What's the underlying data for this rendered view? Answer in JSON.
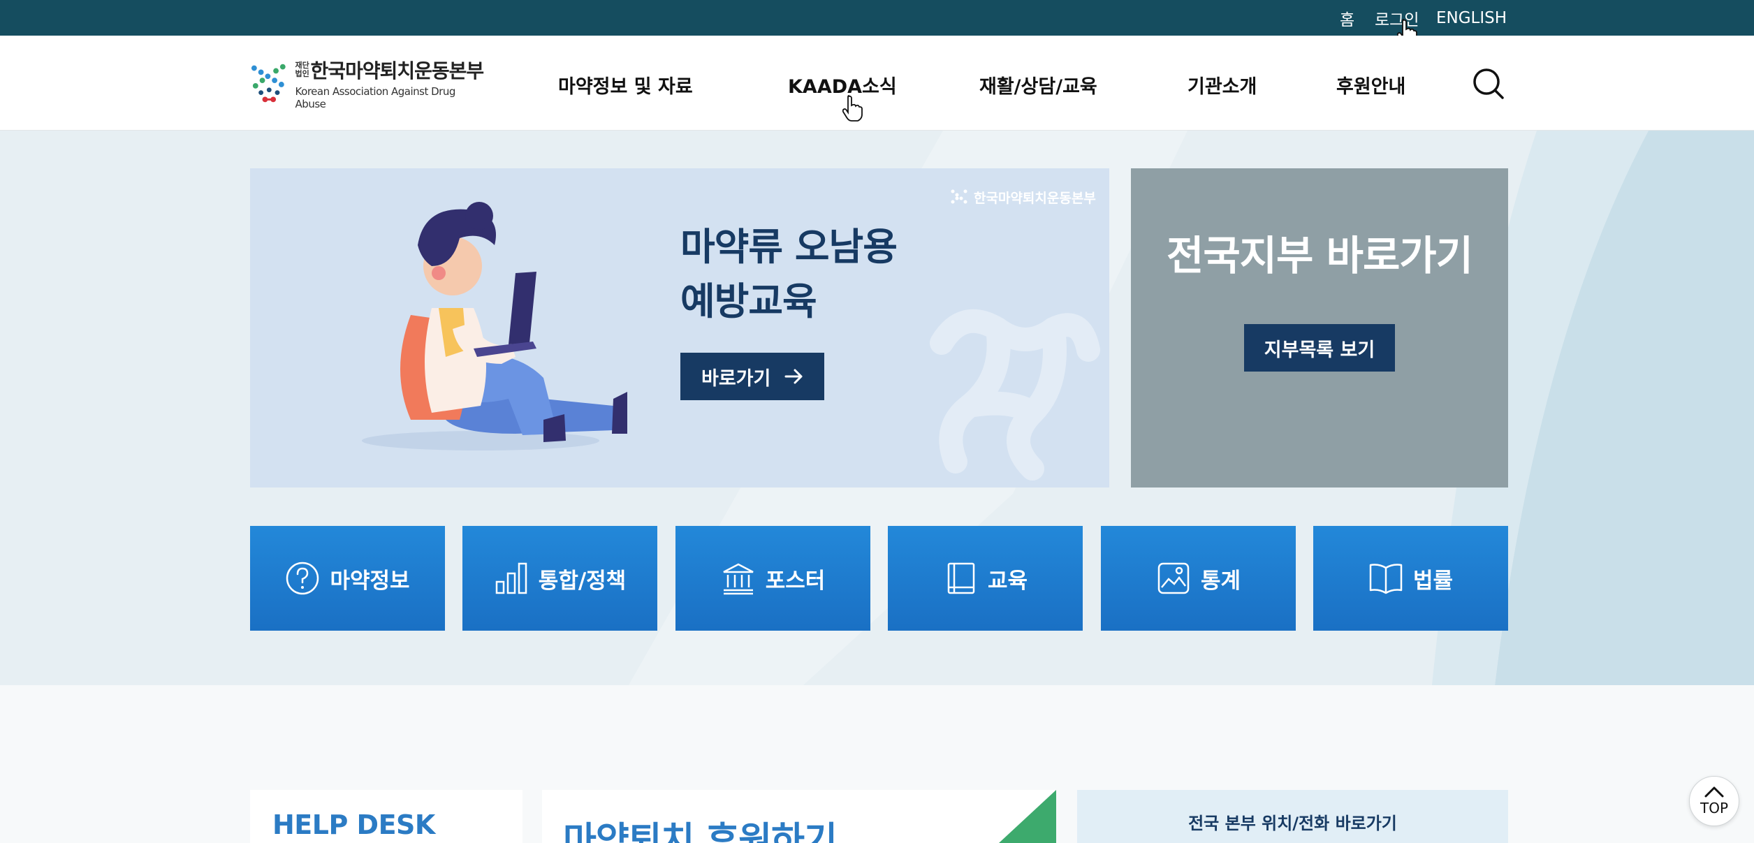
{
  "utility": {
    "home": "홈",
    "login": "로그인",
    "english": "ENGLISH"
  },
  "logo": {
    "prefix": "재단법인",
    "name_kr": "한국마약퇴치운동본부",
    "name_en": "Korean Association Against Drug Abuse"
  },
  "nav": {
    "items": [
      {
        "label": "마약정보 및 자료"
      },
      {
        "label": "KAADA소식"
      },
      {
        "label": "재활/상담/교육"
      },
      {
        "label": "기관소개"
      },
      {
        "label": "후원안내"
      }
    ],
    "search_icon": "search-icon"
  },
  "banner": {
    "title_line1": "마약류 오남용",
    "title_line2": "예방교육",
    "button": "바로가기",
    "watermark": "한국마약퇴치운동본부"
  },
  "branch": {
    "title": "전국지부 바로가기",
    "button": "지부목록 보기"
  },
  "quick_links": [
    {
      "label": "마약정보",
      "icon": "question-icon"
    },
    {
      "label": "통합/정책",
      "icon": "bar-chart-icon"
    },
    {
      "label": "포스터",
      "icon": "building-icon"
    },
    {
      "label": "교육",
      "icon": "notebook-icon"
    },
    {
      "label": "통계",
      "icon": "image-icon"
    },
    {
      "label": "법률",
      "icon": "book-icon"
    }
  ],
  "lower": {
    "help_title": "HELP DESK",
    "donate_title": "마약퇴치 후원하기",
    "location_title": "전국 본부 위치/전화 바로가기"
  },
  "top_button": "TOP",
  "colors": {
    "topbar": "#154d5f",
    "navy": "#173a63",
    "quick_blue": "#1f7fd2",
    "branch_gray": "#8f9fa5",
    "banner_bg": "#d3e1f1",
    "accent_green": "#3daa6d"
  }
}
